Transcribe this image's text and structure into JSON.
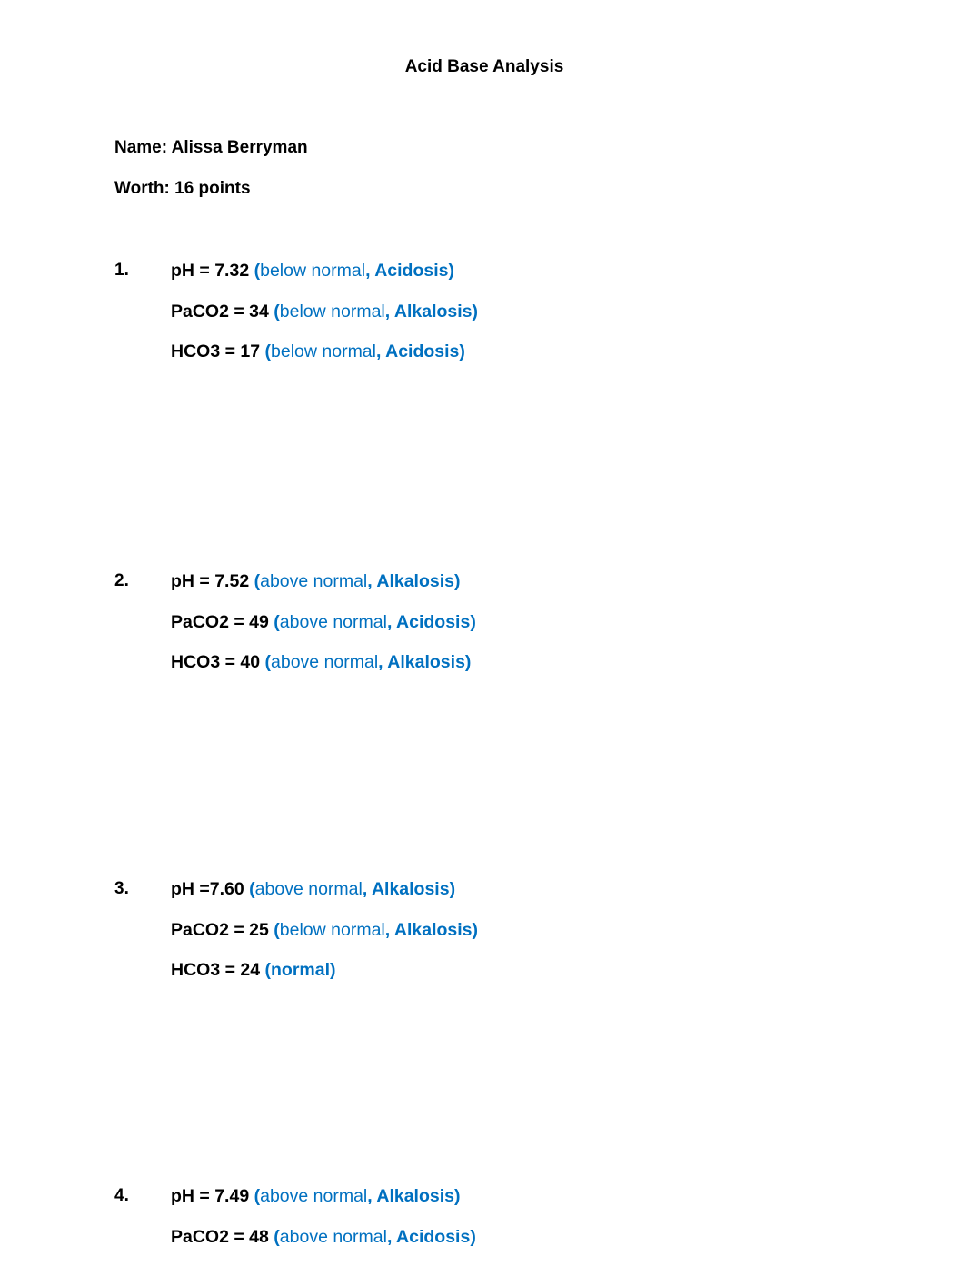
{
  "document": {
    "title": "Acid Base Analysis",
    "name_line": "Name: Alissa Berryman",
    "worth_line": "Worth: 16 points",
    "accent_color": "#0070C0"
  },
  "questions": [
    {
      "number": "1.",
      "lines": [
        {
          "value": "pH = 7.32 ",
          "open": "(",
          "status": "below normal",
          "close": ", Acidosis)"
        },
        {
          "value": "PaCO2 = 34 ",
          "open": "(",
          "status": "below normal",
          "close": ", Alkalosis)"
        },
        {
          "value": "HCO3 = 17 ",
          "open": "(",
          "status": "below normal",
          "close": ", Acidosis)"
        }
      ]
    },
    {
      "number": "2.",
      "lines": [
        {
          "value": "pH = 7.52 ",
          "open": "(",
          "status": "above normal",
          "close": ", Alkalosis)"
        },
        {
          "value": "PaCO2 = 49 ",
          "open": "(",
          "status": "above normal",
          "close": ", Acidosis)"
        },
        {
          "value": "HCO3 = 40 ",
          "open": "(",
          "status": "above normal",
          "close": ", Alkalosis)"
        }
      ]
    },
    {
      "number": "3.",
      "lines": [
        {
          "value": "pH =7.60 ",
          "open": "(",
          "status": "above normal",
          "close": ", Alkalosis)"
        },
        {
          "value": "PaCO2 = 25 ",
          "open": "(",
          "status": "below normal",
          "close": ", Alkalosis)"
        },
        {
          "value": "HCO3 = 24 ",
          "open": "(normal)",
          "status": "",
          "close": ""
        }
      ]
    },
    {
      "number": "4.",
      "lines": [
        {
          "value": "pH = 7.49 ",
          "open": "(",
          "status": "above normal",
          "close": ", Alkalosis)"
        },
        {
          "value": "PaCO2 = 48 ",
          "open": "(",
          "status": "above normal",
          "close": ", Acidosis)"
        }
      ]
    }
  ]
}
